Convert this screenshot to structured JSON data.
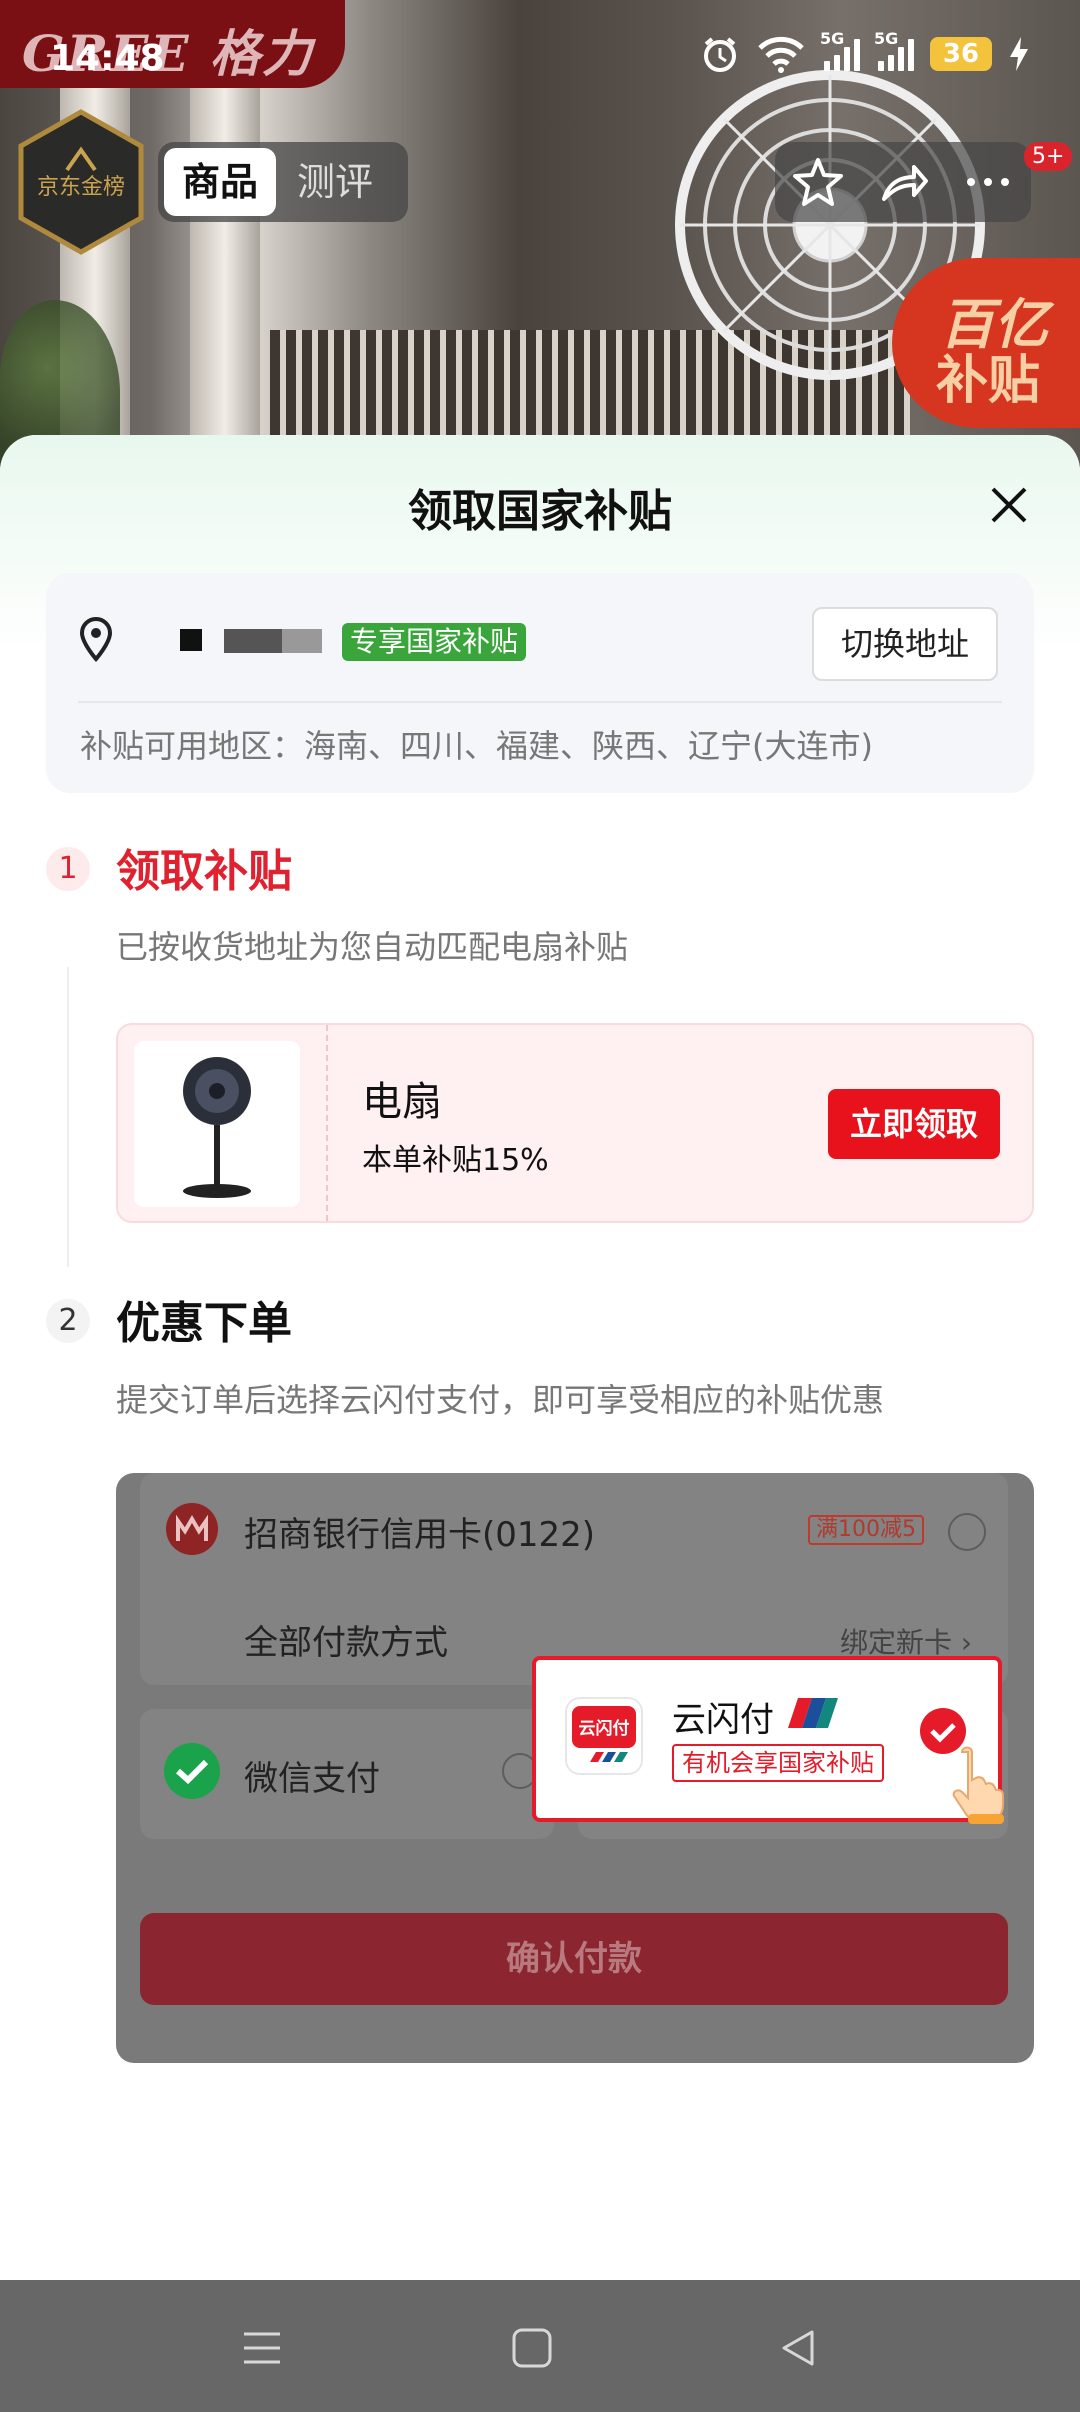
{
  "status_bar": {
    "time": "14:48",
    "signal_1_label": "5G",
    "signal_2_label": "5G",
    "battery": "36"
  },
  "product_header": {
    "brand_text": "GREE 格力",
    "rank_badge_text": "京东金榜",
    "tabs": [
      {
        "label": "商品",
        "selected": true
      },
      {
        "label": "测评",
        "selected": false
      }
    ],
    "more_badge": "5+",
    "subsidy_badge_line1": "百亿",
    "subsidy_badge_line2": "补贴"
  },
  "sheet": {
    "title": "领取国家补贴",
    "address": {
      "tag": "专享国家补贴",
      "switch_label": "切换地址",
      "regions": "补贴可用地区：海南、四川、福建、陕西、辽宁(大连市)"
    },
    "step1": {
      "number": "1",
      "title": "领取补贴",
      "description": "已按收货地址为您自动匹配电扇补贴",
      "product": {
        "name": "电扇",
        "rate": "本单补贴15%",
        "claim_label": "立即领取"
      }
    },
    "step2": {
      "number": "2",
      "title": "优惠下单",
      "description": "提交订单后选择云闪付支付，即可享受相应的补贴优惠",
      "payment": {
        "cmb_label": "招商银行信用卡(0122)",
        "cmb_promo": "满100减5",
        "all_methods_label": "全部付款方式",
        "bind_card_label": "绑定新卡 ›",
        "wechat_label": "微信支付",
        "confirm_label": "确认付款",
        "unionpay_name": "云闪付",
        "unionpay_tag": "有机会享国家补贴",
        "unionpay_logo_text": "云闪付"
      }
    }
  },
  "colors": {
    "accent_red": "#e8121c",
    "tag_green": "#39a53b"
  }
}
